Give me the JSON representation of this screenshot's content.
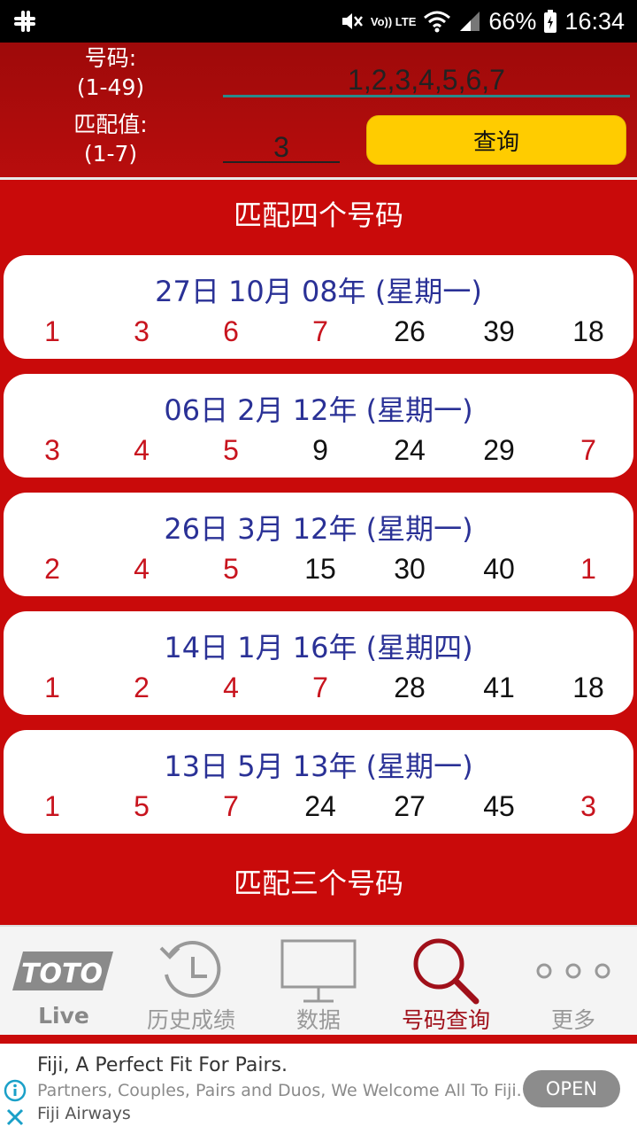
{
  "status_bar": {
    "battery": "66%",
    "time": "16:34",
    "network": "Vo)) LTE"
  },
  "form": {
    "numbers_label": "号码:",
    "numbers_range": "(1-49)",
    "numbers_value": "1,2,3,4,5,6,7",
    "match_label": "匹配值:",
    "match_range": "(1-7)",
    "match_value": "3",
    "query_button": "查询"
  },
  "sections": [
    {
      "title": "匹配四个号码",
      "results": [
        {
          "date": "27日 10月 08年 (星期一)",
          "numbers": [
            {
              "v": "1",
              "match": true
            },
            {
              "v": "3",
              "match": true
            },
            {
              "v": "6",
              "match": true
            },
            {
              "v": "7",
              "match": true
            },
            {
              "v": "26",
              "match": false
            },
            {
              "v": "39",
              "match": false
            },
            {
              "v": "18",
              "match": false
            }
          ]
        },
        {
          "date": "06日 2月 12年 (星期一)",
          "numbers": [
            {
              "v": "3",
              "match": true
            },
            {
              "v": "4",
              "match": true
            },
            {
              "v": "5",
              "match": true
            },
            {
              "v": "9",
              "match": false
            },
            {
              "v": "24",
              "match": false
            },
            {
              "v": "29",
              "match": false
            },
            {
              "v": "7",
              "match": true
            }
          ]
        },
        {
          "date": "26日 3月 12年 (星期一)",
          "numbers": [
            {
              "v": "2",
              "match": true
            },
            {
              "v": "4",
              "match": true
            },
            {
              "v": "5",
              "match": true
            },
            {
              "v": "15",
              "match": false
            },
            {
              "v": "30",
              "match": false
            },
            {
              "v": "40",
              "match": false
            },
            {
              "v": "1",
              "match": true
            }
          ]
        },
        {
          "date": "14日 1月 16年 (星期四)",
          "numbers": [
            {
              "v": "1",
              "match": true
            },
            {
              "v": "2",
              "match": true
            },
            {
              "v": "4",
              "match": true
            },
            {
              "v": "7",
              "match": true
            },
            {
              "v": "28",
              "match": false
            },
            {
              "v": "41",
              "match": false
            },
            {
              "v": "18",
              "match": false
            }
          ]
        },
        {
          "date": "13日 5月 13年 (星期一)",
          "numbers": [
            {
              "v": "1",
              "match": true
            },
            {
              "v": "5",
              "match": true
            },
            {
              "v": "7",
              "match": true
            },
            {
              "v": "24",
              "match": false
            },
            {
              "v": "27",
              "match": false
            },
            {
              "v": "45",
              "match": false
            },
            {
              "v": "3",
              "match": true
            }
          ]
        }
      ]
    },
    {
      "title": "匹配三个号码",
      "results": []
    }
  ],
  "bottom_nav": [
    {
      "label": "Live",
      "icon": "toto-logo-icon",
      "active": false
    },
    {
      "label": "历史成绩",
      "icon": "history-icon",
      "active": false
    },
    {
      "label": "数据",
      "icon": "monitor-icon",
      "active": false
    },
    {
      "label": "号码查询",
      "icon": "search-icon",
      "active": true
    },
    {
      "label": "更多",
      "icon": "more-icon",
      "active": false
    }
  ],
  "toto_logo_text": "TOTO",
  "ad": {
    "title": "Fiji, A Perfect Fit For Pairs.",
    "body": "Partners, Couples, Pairs and Duos, We Welcome All To Fiji.",
    "advertiser": "Fiji Airways",
    "cta": "OPEN"
  },
  "colors": {
    "background_red": "#c90a0a",
    "match_red": "#c8141e",
    "date_blue": "#2a3196",
    "button_yellow": "#ffcc00",
    "active_nav": "#a0101a"
  }
}
